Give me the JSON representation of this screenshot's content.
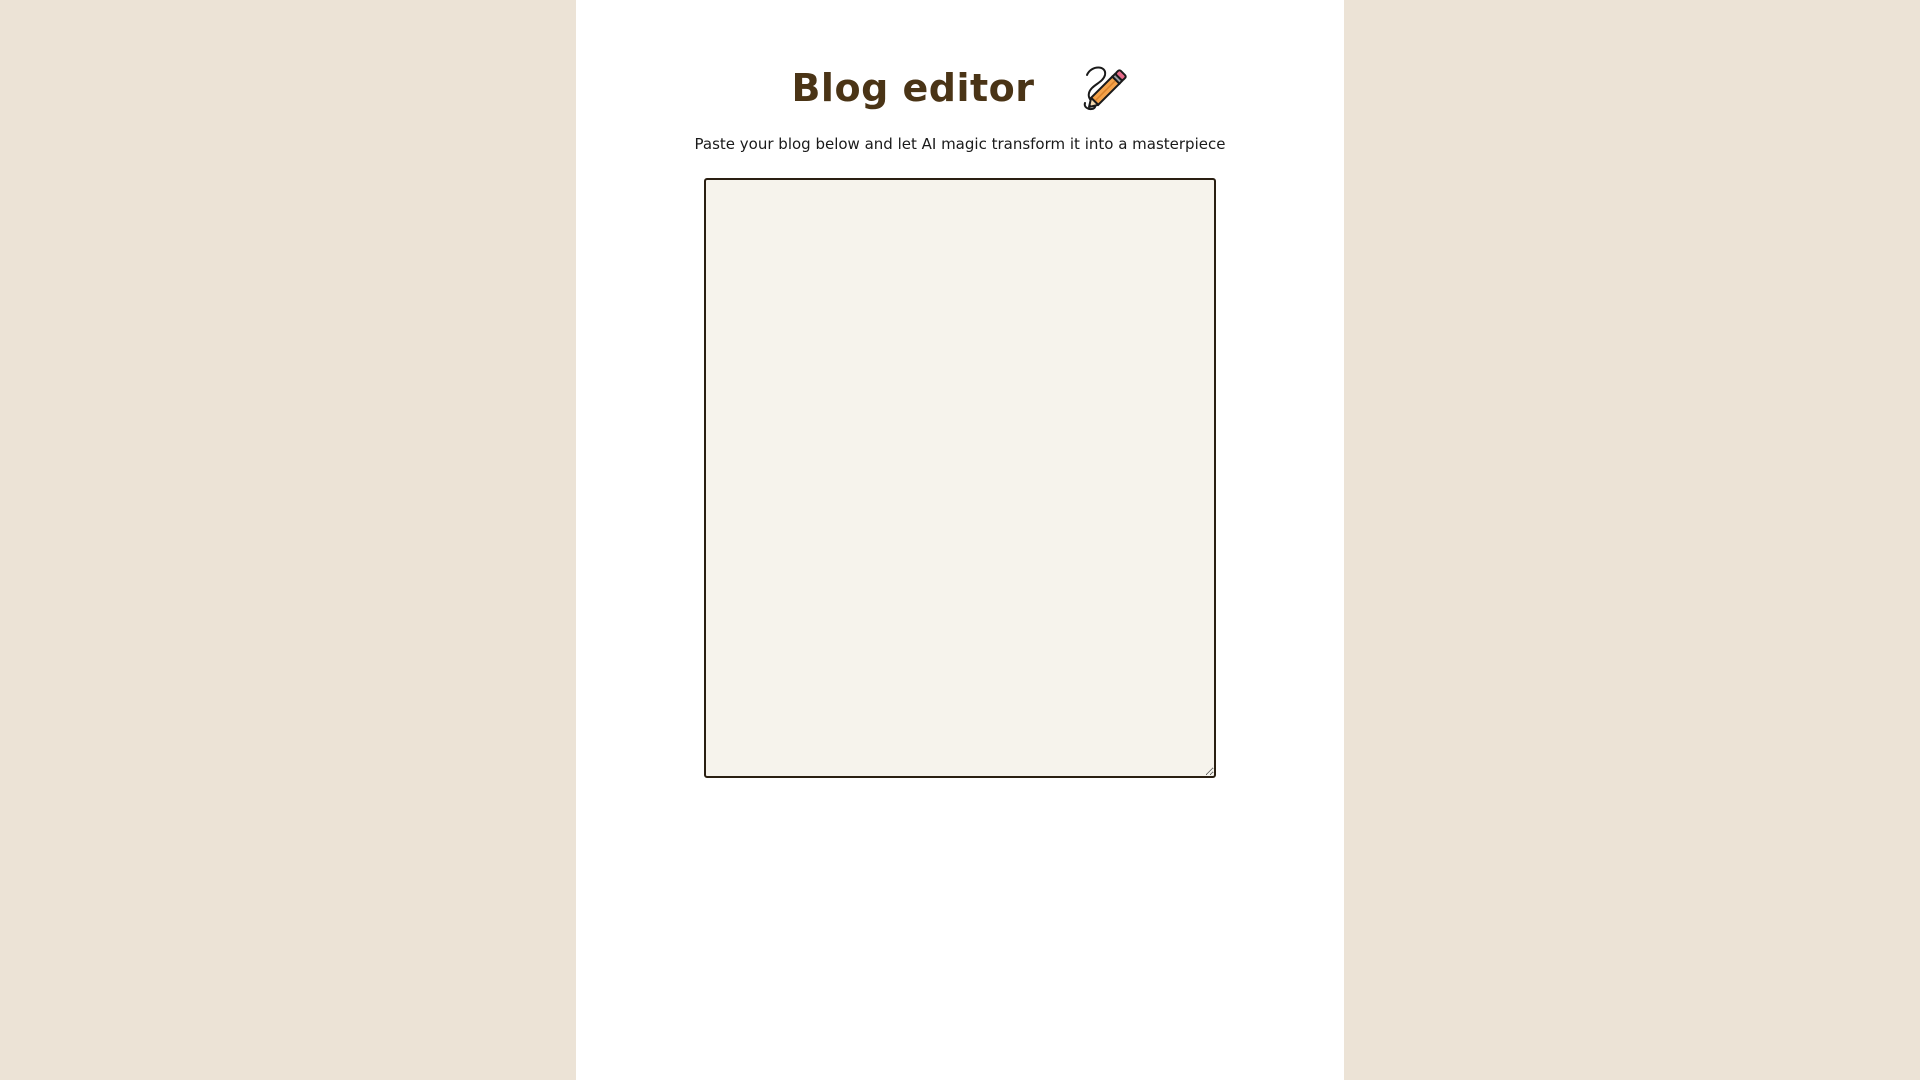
{
  "header": {
    "title": "Blog editor",
    "icon": "pencil-scribble-icon"
  },
  "subtitle": "Paste your blog below and let AI magic transform it into a masterpiece",
  "editor": {
    "value": "",
    "placeholder": ""
  },
  "colors": {
    "page_background": "#ece3d6",
    "panel_background": "#ffffff",
    "title": "#4a3416",
    "editor_background": "#f6f3ec",
    "editor_border": "#2a1f12",
    "pencil_body": "#f4a24a",
    "pencil_eraser": "#e86b8a"
  }
}
